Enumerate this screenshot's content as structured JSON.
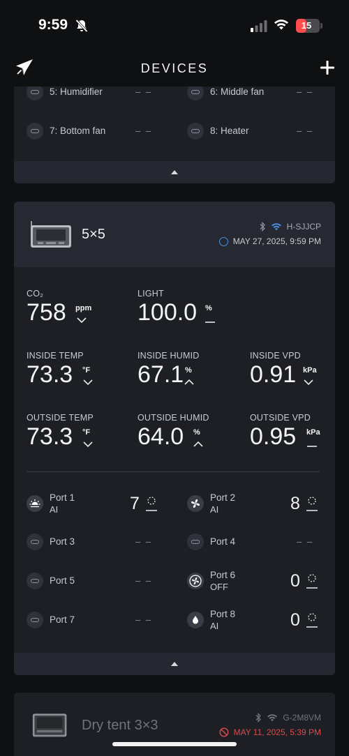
{
  "status_bar": {
    "time": "9:59",
    "battery": "15",
    "battery_level": 0.15,
    "battery_color": "#ff4d4d"
  },
  "nav": {
    "title": "DEVICES",
    "add_icon": "plus-icon",
    "logo_icon": "paper-plane-logo-icon"
  },
  "device1": {
    "ports": [
      {
        "name": "5: Humidifier",
        "value": "– –"
      },
      {
        "name": "6: Middle fan",
        "value": "– –"
      },
      {
        "name": "7: Bottom fan",
        "value": "– –"
      },
      {
        "name": "8: Heater",
        "value": "– –"
      }
    ],
    "collapse_icon": "chevron-up-icon"
  },
  "device2": {
    "name": "5×5",
    "connection_id": "H-SJJCP",
    "timestamp": "MAY 27, 2025, 9:59 PM",
    "metrics": {
      "co2": {
        "label": "CO₂",
        "value": "758",
        "unit": "ppm",
        "trend": "down"
      },
      "light": {
        "label": "LIGHT",
        "value": "100.0",
        "unit": "%",
        "trend": "flat"
      },
      "inside_temp": {
        "label": "INSIDE TEMP",
        "value": "73.3",
        "unit": "°F",
        "trend": "down"
      },
      "inside_humid": {
        "label": "INSIDE HUMID",
        "value": "67.1",
        "unit": "%",
        "trend": "up"
      },
      "inside_vpd": {
        "label": "INSIDE VPD",
        "value": "0.91",
        "unit": "kPa",
        "trend": "down"
      },
      "outside_temp": {
        "label": "OUTSIDE TEMP",
        "value": "73.3",
        "unit": "°F",
        "trend": "down"
      },
      "outside_humid": {
        "label": "OUTSIDE HUMID",
        "value": "64.0",
        "unit": "%",
        "trend": "up"
      },
      "outside_vpd": {
        "label": "OUTSIDE VPD",
        "value": "0.95",
        "unit": "kPa",
        "trend": "flat"
      }
    },
    "ports": [
      {
        "name": "Port 1",
        "mode": "AI",
        "level": "7",
        "icon": "grow-light-icon"
      },
      {
        "name": "Port 2",
        "mode": "AI",
        "level": "8",
        "icon": "fan-icon"
      },
      {
        "name": "Port 3",
        "value": "– –",
        "icon": "outlet-icon"
      },
      {
        "name": "Port 4",
        "value": "– –",
        "icon": "outlet-icon"
      },
      {
        "name": "Port 5",
        "value": "– –",
        "icon": "outlet-icon"
      },
      {
        "name": "Port 6",
        "mode": "OFF",
        "level": "0",
        "icon": "circulation-fan-icon"
      },
      {
        "name": "Port 7",
        "value": "– –",
        "icon": "outlet-icon"
      },
      {
        "name": "Port 8",
        "mode": "AI",
        "level": "0",
        "icon": "humidifier-drop-icon"
      }
    ],
    "collapse_icon": "chevron-up-icon"
  },
  "device3": {
    "name": "Dry tent 3×3",
    "connection_id": "G-2M8VM",
    "timestamp": "MAY 11, 2025, 5:39 PM",
    "offline_color": "#d84c4c"
  }
}
